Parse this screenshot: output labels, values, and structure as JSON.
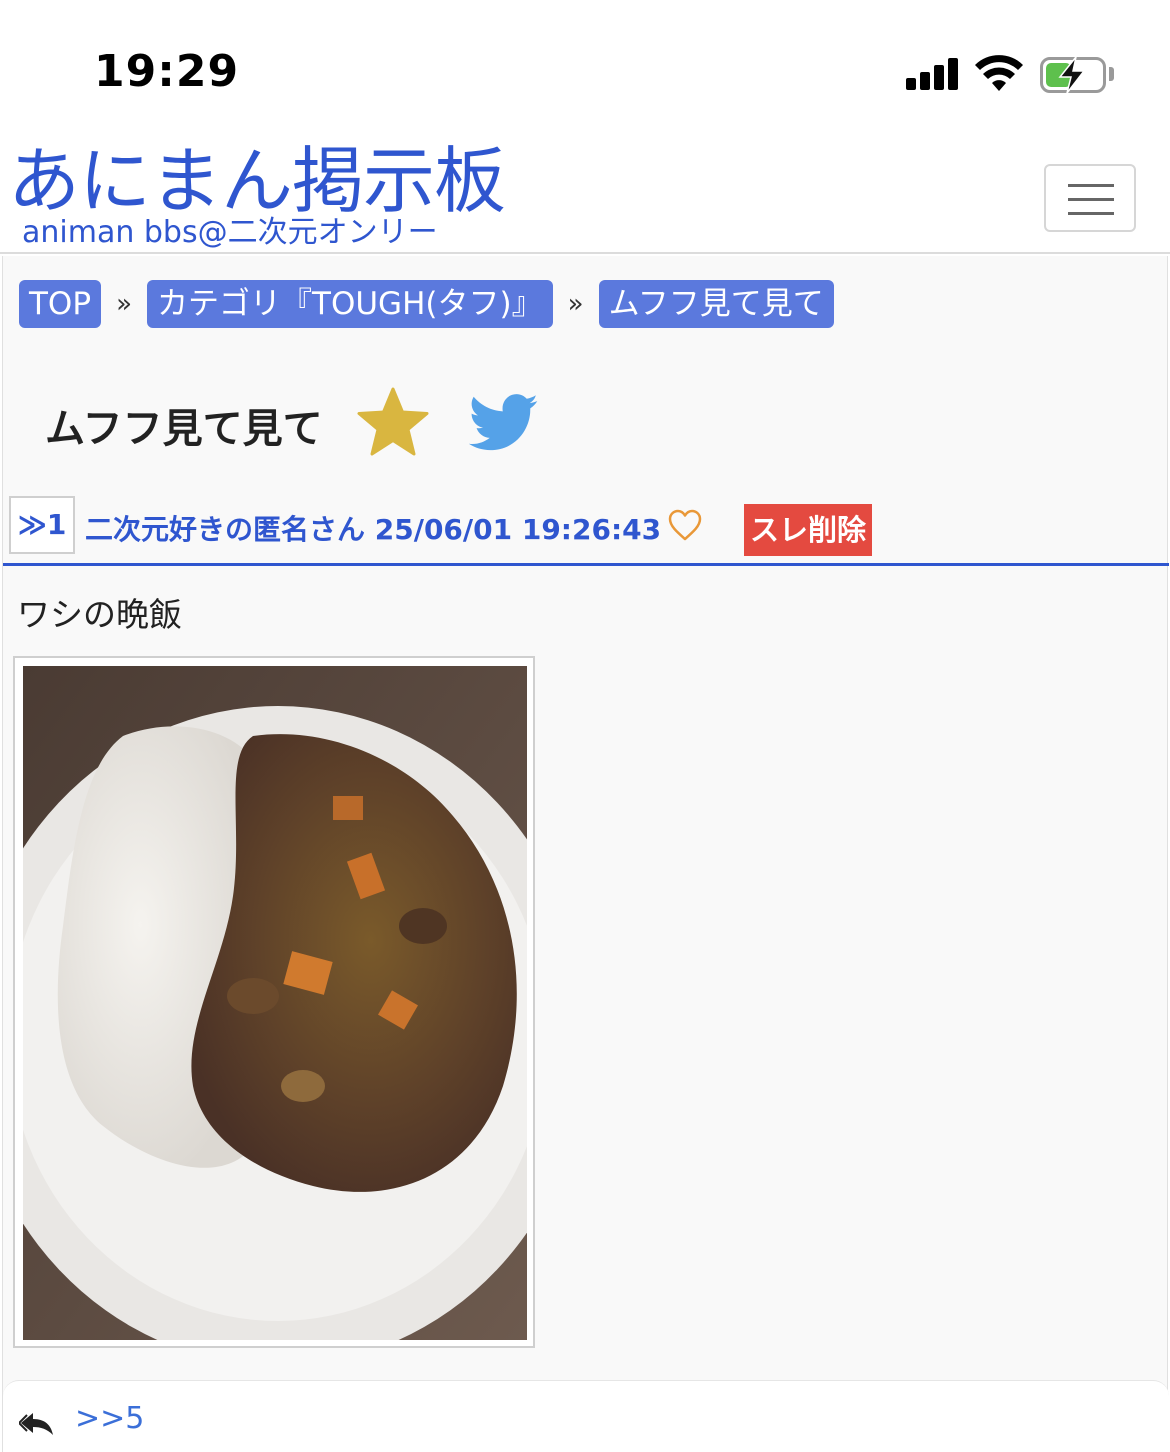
{
  "status_bar": {
    "time": "19:29",
    "icons": [
      "signal-icon",
      "wifi-icon",
      "battery-charging-icon"
    ]
  },
  "header": {
    "logo_title": "あにまん掲示板",
    "logo_subtitle": "animan bbs@二次元オンリー",
    "menu_icon": "hamburger-menu-icon"
  },
  "breadcrumb": {
    "items": [
      {
        "label": "TOP"
      },
      {
        "label": "カテゴリ『TOUGH(タフ)』"
      },
      {
        "label": "ムフフ見て見て"
      }
    ],
    "separator": "»"
  },
  "thread": {
    "title": "ムフフ見て見て",
    "favorite_icon": "star-icon",
    "share_icon": "twitter-icon"
  },
  "post": {
    "res_number": "≫1",
    "meta": "二次元好きの匿名さん 25/06/01 19:26:43",
    "like_icon": "heart-icon",
    "delete_label": "スレ削除",
    "body": "ワシの晩飯",
    "image_alt": "curry-rice-photo",
    "reply_icon": "reply-all-icon",
    "reply_link": ">>5"
  },
  "colors": {
    "accent": "#2f56cf",
    "crumb_bg": "#5b79dd",
    "delete_bg": "#e44a40",
    "star": "#d9b640",
    "twitter": "#55a2e8"
  }
}
